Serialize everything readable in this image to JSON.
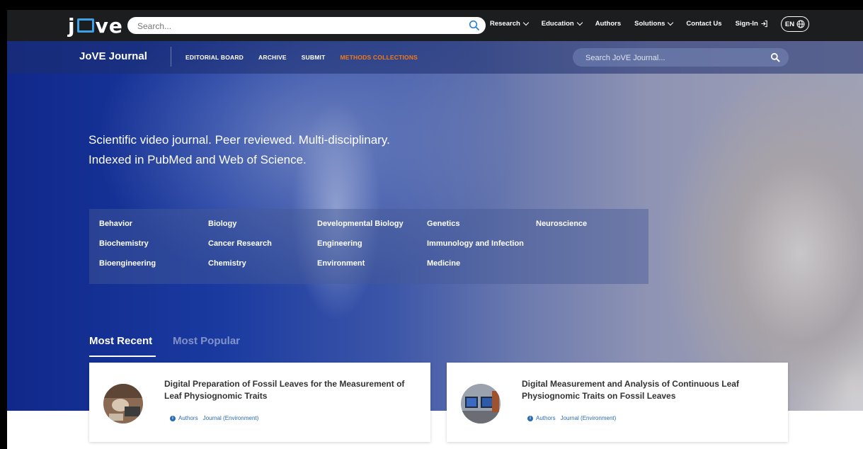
{
  "topnav": {
    "logo": "jove",
    "search_placeholder": "Search...",
    "links": [
      {
        "label": "Research",
        "dropdown": true
      },
      {
        "label": "Education",
        "dropdown": true
      },
      {
        "label": "Authors",
        "dropdown": false
      },
      {
        "label": "Solutions",
        "dropdown": true
      },
      {
        "label": "Contact Us",
        "dropdown": false
      },
      {
        "label": "Sign-In",
        "dropdown": false
      }
    ],
    "language": "EN"
  },
  "subnav": {
    "title": "JoVE Journal",
    "links": [
      "EDITORIAL BOARD",
      "ARCHIVE",
      "SUBMIT",
      "METHODS COLLECTIONS"
    ],
    "search_placeholder": "Search JoVE Journal..."
  },
  "hero": {
    "tagline_line1": "Scientific video journal. Peer reviewed. Multi-disciplinary.",
    "tagline_line2": "Indexed in PubMed and Web of Science."
  },
  "categories": [
    [
      "Behavior",
      "Biochemistry",
      "Bioengineering"
    ],
    [
      "Biology",
      "Cancer Research",
      "Chemistry"
    ],
    [
      "Developmental Biology",
      "Engineering",
      "Environment"
    ],
    [
      "Genetics",
      "Immunology and Infection",
      "Medicine"
    ],
    [
      "Neuroscience"
    ]
  ],
  "tabs": {
    "active": "Most Recent",
    "inactive": "Most Popular"
  },
  "cards": [
    {
      "title": "Digital Preparation of Fossil Leaves for the Measurement of Leaf Physiognomic Traits",
      "authors_label": "Authors",
      "section": "Journal (Environment)"
    },
    {
      "title": "Digital Measurement and Analysis of Continuous Leaf Physiognomic Traits on Fossil Leaves",
      "authors_label": "Authors",
      "section": "Journal (Environment)"
    }
  ],
  "colors": {
    "accent_orange": "#f07a1c",
    "logo_blue": "#3fa0e6",
    "link_blue": "#2a6bb5",
    "topnav_bg": "#1b1d1f"
  }
}
